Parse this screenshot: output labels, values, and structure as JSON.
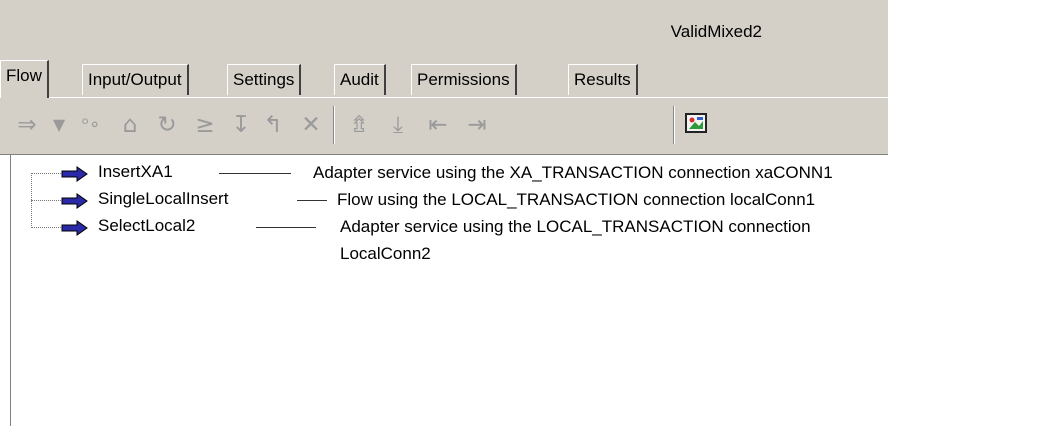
{
  "window": {
    "title": "ValidMixed2"
  },
  "tabs": [
    {
      "label": "Flow",
      "active": true
    },
    {
      "label": "Input/Output"
    },
    {
      "label": "Settings"
    },
    {
      "label": "Audit"
    },
    {
      "label": "Permissions"
    },
    {
      "label": "Results"
    }
  ],
  "toolbar": {
    "buttons": [
      "arrow-right-icon",
      "dropdown-icon",
      "branch-icon",
      "loop-icon",
      "repeat-icon",
      "sequence-icon",
      "exit-icon",
      "return-icon",
      "delete-icon",
      "move-up-icon",
      "move-down-icon",
      "indent-left-icon",
      "indent-right-icon",
      "image-icon"
    ]
  },
  "flow_steps": [
    {
      "name": "InsertXA1",
      "description": "Adapter service using the XA_TRANSACTION connection xaCONN1"
    },
    {
      "name": "SingleLocalInsert",
      "description": "Flow using the LOCAL_TRANSACTION connection localConn1"
    },
    {
      "name": "SelectLocal2",
      "description": "Adapter service using the LOCAL_TRANSACTION connection\nLocalConn2"
    }
  ],
  "colors": {
    "chrome": "#d4d0c8",
    "arrow": "#2a2aa8",
    "disabled_icon": "#9a9a9a"
  }
}
